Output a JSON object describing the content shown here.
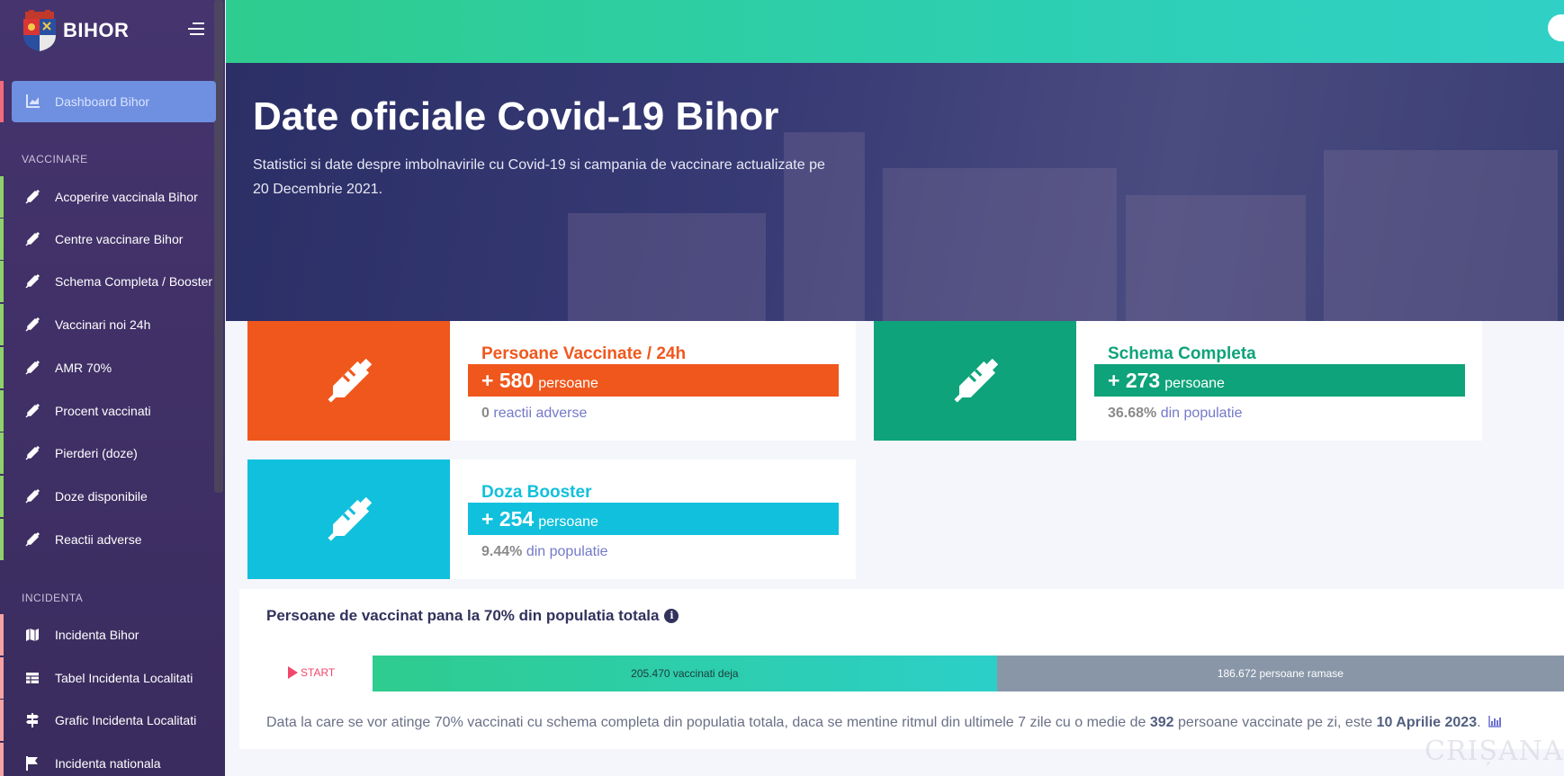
{
  "brand": {
    "name": "BIHOR"
  },
  "sidebar": {
    "active": {
      "label": "Dashboard Bihor",
      "icon": "chart-area-icon"
    },
    "sections": [
      {
        "title": "VACCINARE",
        "items": [
          {
            "label": "Acoperire vaccinala Bihor",
            "icon": "syringe-icon"
          },
          {
            "label": "Centre vaccinare Bihor",
            "icon": "syringe-icon"
          },
          {
            "label": "Schema Completa / Booster",
            "icon": "syringe-icon"
          },
          {
            "label": "Vaccinari noi 24h",
            "icon": "syringe-icon"
          },
          {
            "label": "AMR 70%",
            "icon": "syringe-icon"
          },
          {
            "label": "Procent vaccinati",
            "icon": "syringe-icon"
          },
          {
            "label": "Pierderi (doze)",
            "icon": "syringe-icon"
          },
          {
            "label": "Doze disponibile",
            "icon": "syringe-icon"
          },
          {
            "label": "Reactii adverse",
            "icon": "syringe-icon"
          }
        ]
      },
      {
        "title": "INCIDENTA",
        "items": [
          {
            "label": "Incidenta Bihor",
            "icon": "map-icon"
          },
          {
            "label": "Tabel Incidenta Localitati",
            "icon": "table-icon"
          },
          {
            "label": "Grafic Incidenta Localitati",
            "icon": "signpost-icon"
          },
          {
            "label": "Incidenta nationala",
            "icon": "flag-icon"
          }
        ]
      }
    ]
  },
  "hero": {
    "title": "Date oficiale Covid-19 Bihor",
    "subtitle_line1": "Statistici si date despre imbolnavirile cu Covid-19 si campania de vaccinare actualizate pe",
    "subtitle_line2": "20 Decembrie 2021."
  },
  "cards": [
    {
      "title": "Persoane Vaccinate / 24h",
      "value": "+ 580",
      "unit": "persoane",
      "foot_value": "0",
      "foot_text": "reactii adverse",
      "color": "#f0571d"
    },
    {
      "title": "Schema Completa",
      "value": "+ 273",
      "unit": "persoane",
      "foot_value": "36.68%",
      "foot_text": "din populatie",
      "color": "#0ea37a"
    },
    {
      "title": "Doza Booster",
      "value": "+ 254",
      "unit": "persoane",
      "foot_value": "9.44%",
      "foot_text": "din populatie",
      "color": "#11c0dc"
    }
  ],
  "progress_panel": {
    "title": "Persoane de vaccinat pana la 70% din populatia totala",
    "start_label": "START",
    "done_label": "205.470 vaccinati deja",
    "rest_label": "186.672 persoane ramase",
    "done_fraction": 0.524,
    "note_before": "Data la care se vor atinge 70% vaccinati cu schema completa din populatia totala, daca se mentine ritmul din ultimele 7 zile cu o medie de",
    "note_daily": "392",
    "note_middle": "persoane vaccinate pe zi, este",
    "note_date": "10 Aprilie 2023",
    "note_end": "."
  },
  "watermark": "CRIȘANA"
}
